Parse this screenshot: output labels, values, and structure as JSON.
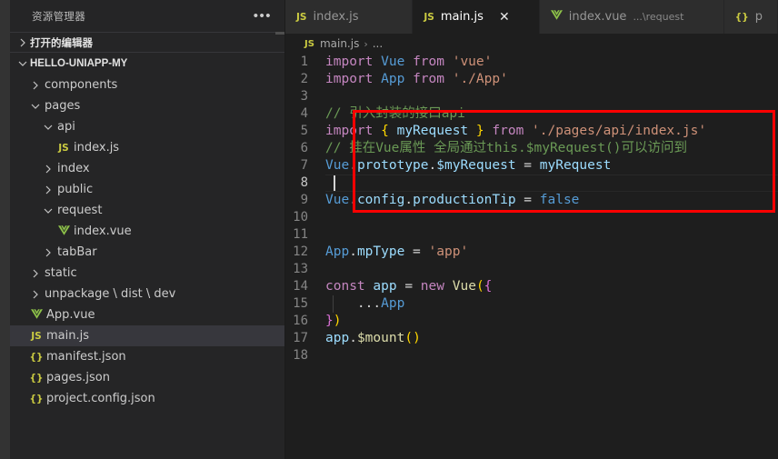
{
  "sidebar": {
    "title": "资源管理器",
    "more_icon": "more-icon",
    "sections": [
      {
        "label": "打开的编辑器",
        "expanded": false,
        "chevron": "chevron-right-icon"
      },
      {
        "label": "HELLO-UNIAPP-MY",
        "expanded": true,
        "chevron": "chevron-down-icon"
      }
    ],
    "tree": [
      {
        "label": "components",
        "type": "folder",
        "expanded": false,
        "indent": 1,
        "icon": "chevron-right-icon"
      },
      {
        "label": "pages",
        "type": "folder",
        "expanded": true,
        "indent": 1,
        "icon": "chevron-down-icon"
      },
      {
        "label": "api",
        "type": "folder",
        "expanded": true,
        "indent": 2,
        "icon": "chevron-down-icon"
      },
      {
        "label": "index.js",
        "type": "js",
        "indent": 3,
        "icon": "js-file-icon"
      },
      {
        "label": "index",
        "type": "folder",
        "expanded": false,
        "indent": 2,
        "icon": "chevron-right-icon"
      },
      {
        "label": "public",
        "type": "folder",
        "expanded": false,
        "indent": 2,
        "icon": "chevron-right-icon"
      },
      {
        "label": "request",
        "type": "folder",
        "expanded": true,
        "indent": 2,
        "icon": "chevron-down-icon"
      },
      {
        "label": "index.vue",
        "type": "vue",
        "indent": 3,
        "icon": "vue-file-icon"
      },
      {
        "label": "tabBar",
        "type": "folder",
        "expanded": false,
        "indent": 2,
        "icon": "chevron-right-icon"
      },
      {
        "label": "static",
        "type": "folder",
        "expanded": false,
        "indent": 1,
        "icon": "chevron-right-icon"
      },
      {
        "label": "unpackage \\ dist \\ dev",
        "type": "folder",
        "expanded": false,
        "indent": 1,
        "icon": "chevron-right-icon"
      },
      {
        "label": "App.vue",
        "type": "vue",
        "indent": 1,
        "icon": "vue-file-icon"
      },
      {
        "label": "main.js",
        "type": "js",
        "indent": 1,
        "icon": "js-file-icon",
        "selected": true
      },
      {
        "label": "manifest.json",
        "type": "json",
        "indent": 1,
        "icon": "json-file-icon"
      },
      {
        "label": "pages.json",
        "type": "json",
        "indent": 1,
        "icon": "json-file-icon"
      },
      {
        "label": "project.config.json",
        "type": "json",
        "indent": 1,
        "icon": "json-file-icon"
      }
    ]
  },
  "tabs": [
    {
      "label": "index.js",
      "icon": "js-file-icon",
      "icon_text": "JS",
      "active": false,
      "description": "",
      "closable": false
    },
    {
      "label": "main.js",
      "icon": "js-file-icon",
      "icon_text": "JS",
      "active": true,
      "description": "",
      "closable": true,
      "close_glyph": "✕"
    },
    {
      "label": "index.vue",
      "icon": "vue-file-icon",
      "icon_text": "V",
      "active": false,
      "description": "...\\request",
      "closable": false
    },
    {
      "label": "p",
      "icon": "json-file-icon",
      "icon_text": "{}",
      "active": false,
      "description": "",
      "closable": false
    }
  ],
  "breadcrumb": {
    "icon_text": "JS",
    "file": "main.js",
    "separator": "›",
    "tail": "..."
  },
  "editor": {
    "current_line": 8,
    "lines": [
      {
        "n": "1",
        "tokens": [
          {
            "t": "import",
            "c": "t-kw"
          },
          {
            "t": " ",
            "c": "t-plain"
          },
          {
            "t": "Vue",
            "c": "t-blue"
          },
          {
            "t": " ",
            "c": "t-plain"
          },
          {
            "t": "from",
            "c": "t-kw"
          },
          {
            "t": " ",
            "c": "t-plain"
          },
          {
            "t": "'vue'",
            "c": "t-str"
          }
        ]
      },
      {
        "n": "2",
        "tokens": [
          {
            "t": "import",
            "c": "t-kw"
          },
          {
            "t": " ",
            "c": "t-plain"
          },
          {
            "t": "App",
            "c": "t-blue"
          },
          {
            "t": " ",
            "c": "t-plain"
          },
          {
            "t": "from",
            "c": "t-kw"
          },
          {
            "t": " ",
            "c": "t-plain"
          },
          {
            "t": "'./App'",
            "c": "t-str"
          }
        ]
      },
      {
        "n": "3",
        "tokens": []
      },
      {
        "n": "4",
        "tokens": [
          {
            "t": "// 引入封装的接口api",
            "c": "t-com"
          }
        ]
      },
      {
        "n": "5",
        "tokens": [
          {
            "t": "import",
            "c": "t-kw"
          },
          {
            "t": " ",
            "c": "t-plain"
          },
          {
            "t": "{",
            "c": "t-br1"
          },
          {
            "t": " ",
            "c": "t-plain"
          },
          {
            "t": "myRequest",
            "c": "t-var"
          },
          {
            "t": " ",
            "c": "t-plain"
          },
          {
            "t": "}",
            "c": "t-br1"
          },
          {
            "t": " ",
            "c": "t-plain"
          },
          {
            "t": "from",
            "c": "t-kw"
          },
          {
            "t": " ",
            "c": "t-plain"
          },
          {
            "t": "'./pages/api/index.js'",
            "c": "t-str"
          }
        ]
      },
      {
        "n": "6",
        "tokens": [
          {
            "t": "// 挂在Vue属性 全局通过this.$myRequest()可以访问到",
            "c": "t-com"
          }
        ]
      },
      {
        "n": "7",
        "tokens": [
          {
            "t": "Vue",
            "c": "t-blue"
          },
          {
            "t": ".",
            "c": "t-op"
          },
          {
            "t": "prototype",
            "c": "t-var"
          },
          {
            "t": ".",
            "c": "t-op"
          },
          {
            "t": "$myRequest",
            "c": "t-var"
          },
          {
            "t": " = ",
            "c": "t-op"
          },
          {
            "t": "myRequest",
            "c": "t-var"
          }
        ]
      },
      {
        "n": "8",
        "tokens": []
      },
      {
        "n": "9",
        "tokens": [
          {
            "t": "Vue",
            "c": "t-blue"
          },
          {
            "t": ".",
            "c": "t-op"
          },
          {
            "t": "config",
            "c": "t-var"
          },
          {
            "t": ".",
            "c": "t-op"
          },
          {
            "t": "productionTip",
            "c": "t-var"
          },
          {
            "t": " = ",
            "c": "t-op"
          },
          {
            "t": "false",
            "c": "t-blue"
          }
        ]
      },
      {
        "n": "10",
        "tokens": []
      },
      {
        "n": "11",
        "tokens": []
      },
      {
        "n": "12",
        "tokens": [
          {
            "t": "App",
            "c": "t-blue"
          },
          {
            "t": ".",
            "c": "t-op"
          },
          {
            "t": "mpType",
            "c": "t-var"
          },
          {
            "t": " = ",
            "c": "t-op"
          },
          {
            "t": "'app'",
            "c": "t-str"
          }
        ]
      },
      {
        "n": "13",
        "tokens": []
      },
      {
        "n": "14",
        "tokens": [
          {
            "t": "const",
            "c": "t-kw"
          },
          {
            "t": " ",
            "c": "t-plain"
          },
          {
            "t": "app",
            "c": "t-var"
          },
          {
            "t": " = ",
            "c": "t-op"
          },
          {
            "t": "new",
            "c": "t-kw"
          },
          {
            "t": " ",
            "c": "t-plain"
          },
          {
            "t": "Vue",
            "c": "t-fn"
          },
          {
            "t": "(",
            "c": "t-br1"
          },
          {
            "t": "{",
            "c": "t-br2"
          }
        ]
      },
      {
        "n": "15",
        "tokens": [
          {
            "t": "    ...",
            "c": "t-op"
          },
          {
            "t": "App",
            "c": "t-blue"
          }
        ],
        "guide": true
      },
      {
        "n": "16",
        "tokens": [
          {
            "t": "}",
            "c": "t-br2"
          },
          {
            "t": ")",
            "c": "t-br1"
          }
        ]
      },
      {
        "n": "17",
        "tokens": [
          {
            "t": "app",
            "c": "t-var"
          },
          {
            "t": ".",
            "c": "t-op"
          },
          {
            "t": "$mount",
            "c": "t-fn"
          },
          {
            "t": "(",
            "c": "t-br1"
          },
          {
            "t": ")",
            "c": "t-br1"
          }
        ]
      },
      {
        "n": "18",
        "tokens": []
      }
    ]
  },
  "annotation": {
    "name": "red-highlight-box",
    "color": "#ff0000",
    "covers_lines": "4-8"
  },
  "colors": {
    "editor_bg": "#1e1e1e",
    "sidebar_bg": "#252526",
    "tab_active_bg": "#1e1e1e",
    "tab_inactive_bg": "#2d2d2d",
    "selection_bg": "#37373d",
    "accent_red": "#ff0000"
  }
}
